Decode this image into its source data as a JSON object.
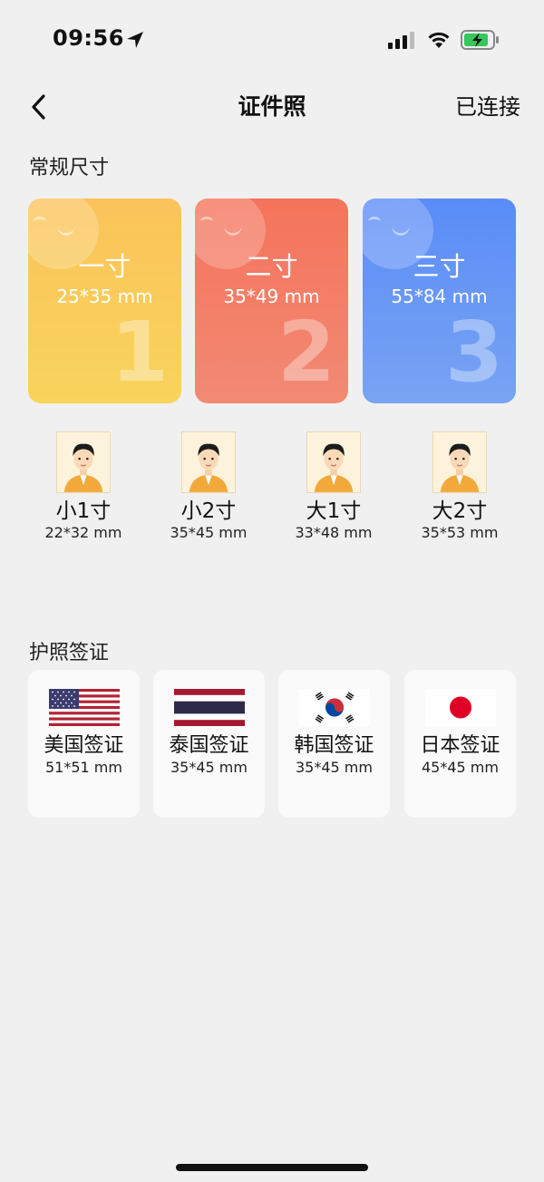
{
  "status_bar": {
    "time": "09:56"
  },
  "nav": {
    "title": "证件照",
    "right_label": "已连接"
  },
  "sections": {
    "regular": "常规尺寸",
    "passport": "护照签证"
  },
  "big_cards": [
    {
      "label": "一寸",
      "size": "25*35 mm",
      "number": "1"
    },
    {
      "label": "二寸",
      "size": "35*49 mm",
      "number": "2"
    },
    {
      "label": "三寸",
      "size": "55*84 mm",
      "number": "3"
    }
  ],
  "small_sizes": [
    {
      "label": "小1寸",
      "size": "22*32 mm"
    },
    {
      "label": "小2寸",
      "size": "35*45 mm"
    },
    {
      "label": "大1寸",
      "size": "33*48 mm"
    },
    {
      "label": "大2寸",
      "size": "35*53 mm"
    }
  ],
  "visas": [
    {
      "label": "美国签证",
      "size": "51*51 mm",
      "flag": "us-flag-icon"
    },
    {
      "label": "泰国签证",
      "size": "35*45 mm",
      "flag": "thailand-flag-icon"
    },
    {
      "label": "韩国签证",
      "size": "35*45 mm",
      "flag": "korea-flag-icon"
    },
    {
      "label": "日本签证",
      "size": "45*45 mm",
      "flag": "japan-flag-icon"
    }
  ],
  "colors": {
    "card1": "#fbc35a",
    "card2": "#f5735b",
    "card3": "#5a8cf7",
    "background": "#f0f0f0",
    "battery": "#34c759"
  }
}
